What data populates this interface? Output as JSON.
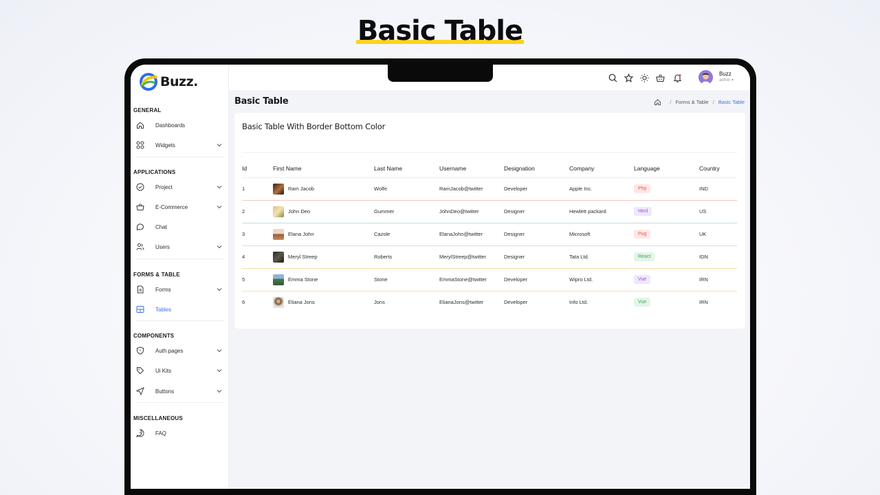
{
  "hero": {
    "title": "Basic Table"
  },
  "sidebar": {
    "logo_text": "Buzz.",
    "sections": {
      "general": "GENERAL",
      "applications": "APPLICATIONS",
      "forms_table": "FORMS & TABLE",
      "components": "COMPONENTS",
      "miscellaneous": "MISCELLANEOUS"
    },
    "items": {
      "dashboards": "Dashboards",
      "widgets": "Widgets",
      "project": "Project",
      "ecommerce": "E-Commerce",
      "chat": "Chat",
      "users": "Users",
      "forms": "Forms",
      "tables": "Tables",
      "auth_pages": "Auth pages",
      "ui_kits": "Ui Kits",
      "buttons": "Buttons",
      "faq": "FAQ"
    }
  },
  "topbar": {
    "user_name": "Buzz",
    "user_role": "admin",
    "icons": [
      "search-icon",
      "star-icon",
      "sun-icon",
      "basket-icon",
      "bell-icon"
    ]
  },
  "page": {
    "title": "Basic Table",
    "breadcrumb": {
      "parent": "Forms & Table",
      "current": "Basic Table"
    }
  },
  "card": {
    "title": "Basic Table With Border Bottom Color",
    "columns": [
      "Id",
      "First Name",
      "Last Name",
      "Username",
      "Designation",
      "Company",
      "Language",
      "Country"
    ],
    "rows": [
      {
        "id": "1",
        "first": "Ram Jacob",
        "last": "Wolfe",
        "username": "RamJacob@twitter",
        "designation": "Developer",
        "company": "Apple Inc.",
        "language": "Php",
        "country": "IND",
        "lang_color": "#f0564a",
        "lang_bg": "#fde8e6",
        "border_color": "#f3c7c2"
      },
      {
        "id": "2",
        "first": "John Deo",
        "last": "Gummer",
        "username": "JohnDeo@twitter",
        "designation": "Designer",
        "company": "Hewlett packard",
        "language": "Html",
        "country": "US",
        "lang_color": "#8a5cd8",
        "lang_bg": "#efe7fb",
        "border_color": "#c7dcdb"
      },
      {
        "id": "3",
        "first": "Elana John",
        "last": "Cazole",
        "username": "ElanaJohn@twitter",
        "designation": "Designer",
        "company": "Microsoft",
        "language": "Pug",
        "country": "UK",
        "lang_color": "#f0564a",
        "lang_bg": "#fde8e6",
        "border_color": "#c9e4e5"
      },
      {
        "id": "4",
        "first": "Meryl Streep",
        "last": "Roberts",
        "username": "MerylStreep@twitter",
        "designation": "Designer",
        "company": "Tata Ltd.",
        "language": "React",
        "country": "IDN",
        "lang_color": "#39a85a",
        "lang_bg": "#e3f5e7",
        "border_color": "#f6dca0"
      },
      {
        "id": "5",
        "first": "Emma Stone",
        "last": "Stone",
        "username": "EmmaStone@twitter",
        "designation": "Developer",
        "company": "Wipro Ltd.",
        "language": "Vue",
        "country": "IRN",
        "lang_color": "#8a5cd8",
        "lang_bg": "#efe7fb",
        "border_color": "#f6dfc3"
      },
      {
        "id": "6",
        "first": "Eliana Jons",
        "last": "Jons",
        "username": "ElianaJons@twitter",
        "designation": "Developer",
        "company": "Info Ltd.",
        "language": "Vue",
        "country": "IRN",
        "lang_color": "#39a85a",
        "lang_bg": "#e3f5e7",
        "border_color": "none"
      }
    ]
  },
  "colors": {
    "accent": "#3c73e6",
    "highlight": "#ffd21f"
  }
}
